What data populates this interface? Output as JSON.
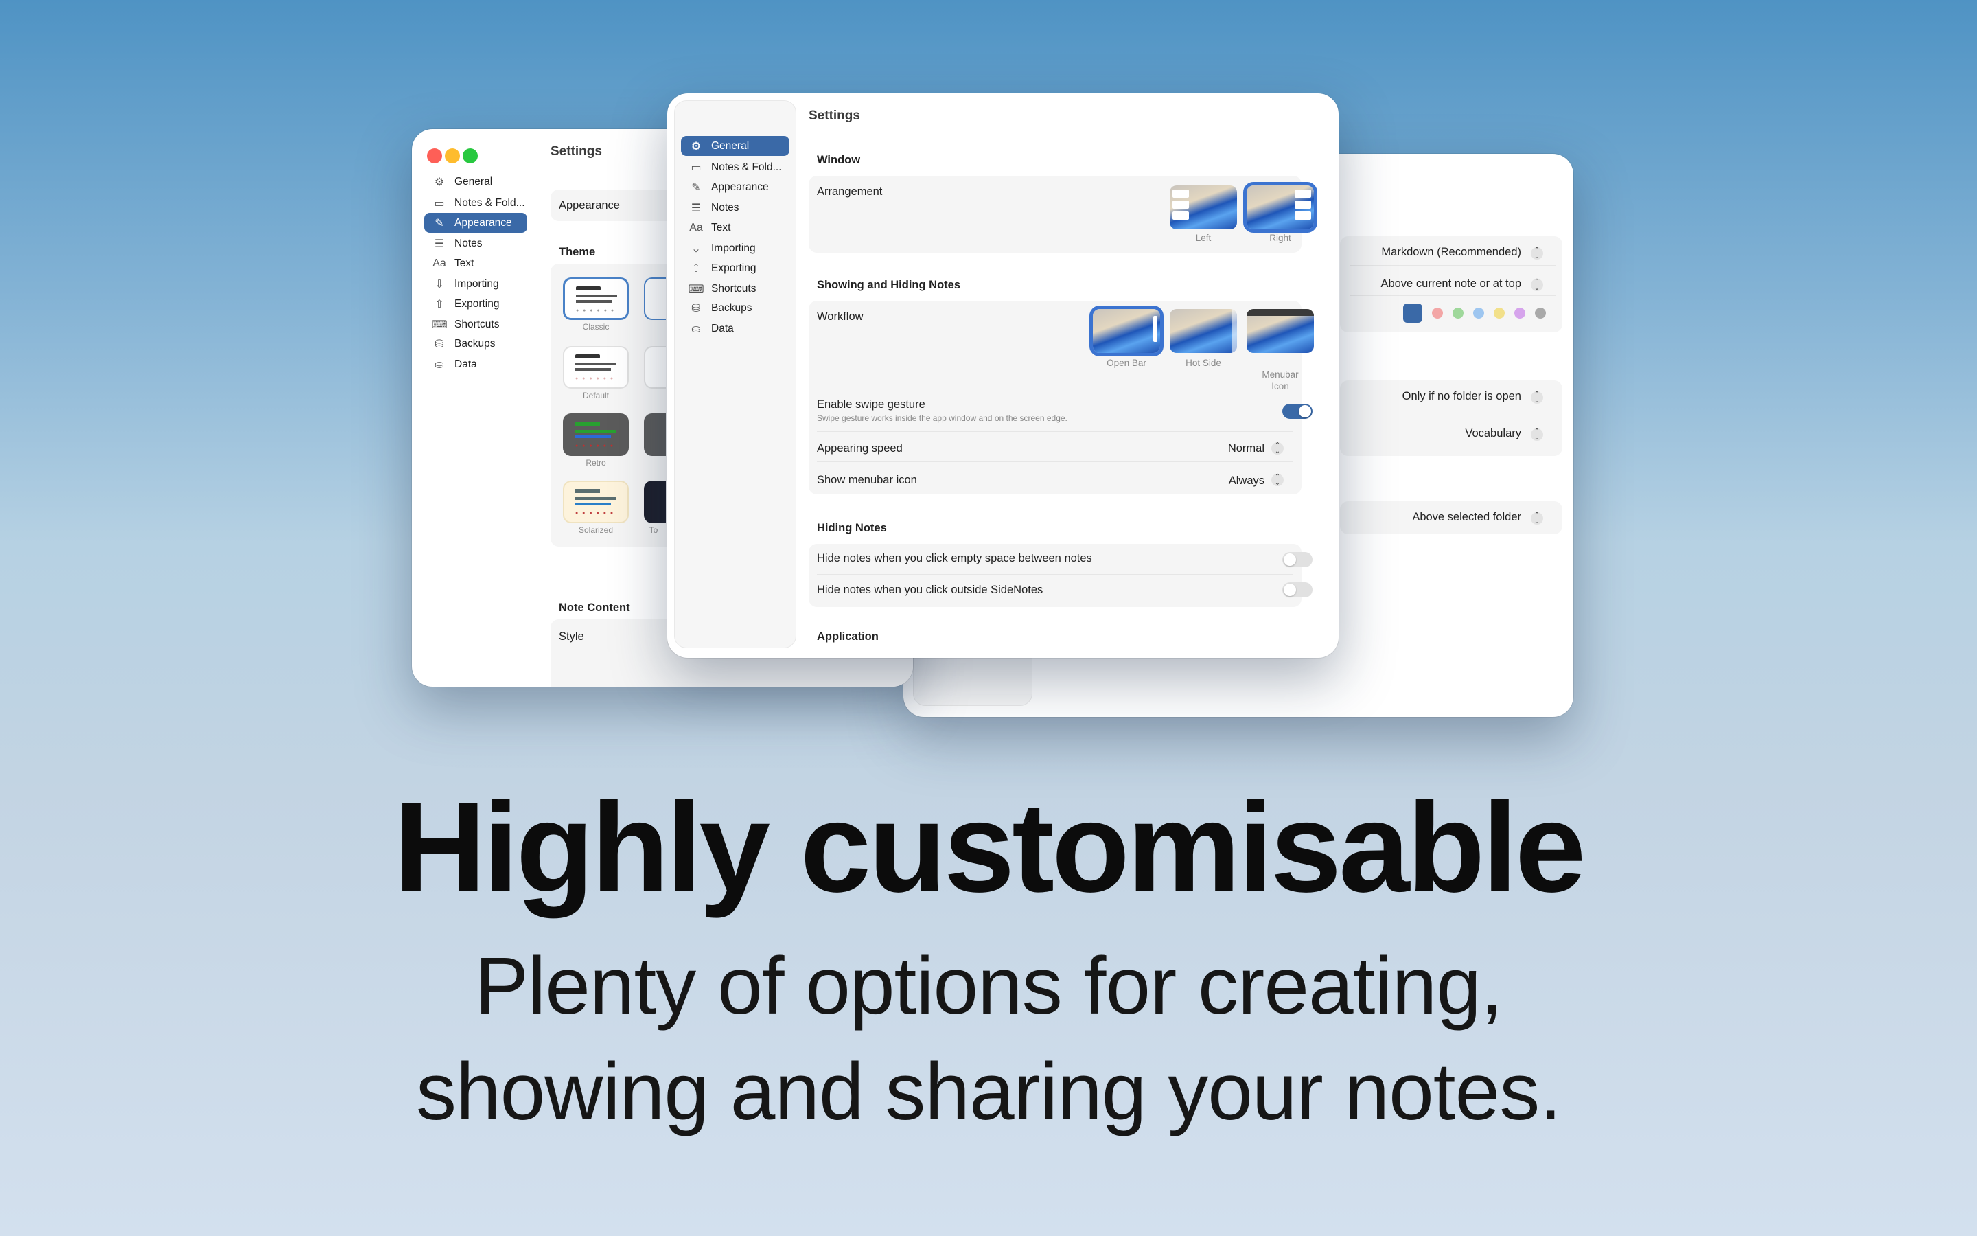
{
  "back_left_window": {
    "title": "Settings",
    "sidebar": [
      {
        "icon": "gear-icon",
        "glyph": "⚙",
        "label": "General"
      },
      {
        "icon": "folder-icon",
        "glyph": "▭",
        "label": "Notes & Fold..."
      },
      {
        "icon": "brush-icon",
        "glyph": "✎",
        "label": "Appearance"
      },
      {
        "icon": "note-icon",
        "glyph": "☰",
        "label": "Notes"
      },
      {
        "icon": "text-icon",
        "glyph": "Aa",
        "label": "Text"
      },
      {
        "icon": "import-icon",
        "glyph": "⇩",
        "label": "Importing"
      },
      {
        "icon": "export-icon",
        "glyph": "⇧",
        "label": "Exporting"
      },
      {
        "icon": "keyboard-icon",
        "glyph": "⌨",
        "label": "Shortcuts"
      },
      {
        "icon": "backup-icon",
        "glyph": "⛁",
        "label": "Backups"
      },
      {
        "icon": "data-icon",
        "glyph": "⛀",
        "label": "Data"
      }
    ],
    "selected": "Appearance",
    "appearance_label": "Appearance",
    "theme_heading": "Theme",
    "themes": [
      "Classic",
      "Default",
      "Retro",
      "Solarized"
    ],
    "theme_partial": "To",
    "note_content_heading": "Note Content",
    "style_label": "Style"
  },
  "back_right_window": {
    "rows": [
      "Markdown (Recommended)",
      "Above current note or at top",
      "Only if no folder is open",
      "Vocabulary",
      "Above selected folder"
    ],
    "colors": [
      "#3a69a7",
      "#f3a6a6",
      "#9fd89b",
      "#9ec6f0",
      "#f2e08a",
      "#d6a4ec",
      "#a9a9a9"
    ]
  },
  "front_window": {
    "title": "Settings",
    "sidebar": [
      {
        "icon": "gear-icon",
        "glyph": "⚙",
        "label": "General"
      },
      {
        "icon": "folder-icon",
        "glyph": "▭",
        "label": "Notes & Fold..."
      },
      {
        "icon": "brush-icon",
        "glyph": "✎",
        "label": "Appearance"
      },
      {
        "icon": "note-icon",
        "glyph": "☰",
        "label": "Notes"
      },
      {
        "icon": "text-icon",
        "glyph": "Aa",
        "label": "Text"
      },
      {
        "icon": "import-icon",
        "glyph": "⇩",
        "label": "Importing"
      },
      {
        "icon": "export-icon",
        "glyph": "⇧",
        "label": "Exporting"
      },
      {
        "icon": "keyboard-icon",
        "glyph": "⌨",
        "label": "Shortcuts"
      },
      {
        "icon": "backup-icon",
        "glyph": "⛁",
        "label": "Backups"
      },
      {
        "icon": "data-icon",
        "glyph": "⛀",
        "label": "Data"
      }
    ],
    "selected": "General",
    "window_heading": "Window",
    "arrangement_label": "Arrangement",
    "arrangement_options": [
      "Left",
      "Right"
    ],
    "arrangement_selected": "Right",
    "showing_heading": "Showing and Hiding Notes",
    "workflow_label": "Workflow",
    "workflow_options": [
      "Open Bar",
      "Hot Side",
      "Menubar\nIcon"
    ],
    "workflow_selected": "Open Bar",
    "swipe_label": "Enable swipe gesture",
    "swipe_desc": "Swipe gesture works inside the app window and on the screen edge.",
    "swipe_on": true,
    "speed_label": "Appearing speed",
    "speed_value": "Normal",
    "menubar_label": "Show menubar icon",
    "menubar_value": "Always",
    "hiding_heading": "Hiding Notes",
    "hide_empty_label": "Hide notes when you click empty space between notes",
    "hide_empty_on": false,
    "hide_outside_label": "Hide notes when you click outside SideNotes",
    "hide_outside_on": false,
    "application_heading": "Application"
  },
  "headline": "Highly customisable",
  "subline_1": "Plenty of options for creating,",
  "subline_2": "showing and sharing your notes."
}
